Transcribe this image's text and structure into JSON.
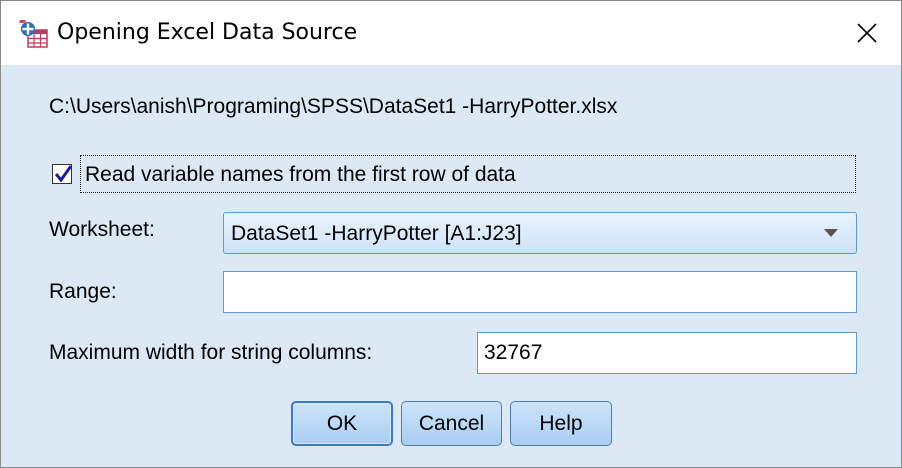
{
  "window": {
    "title": "Opening Excel Data Source",
    "app_icon": "spss-data-icon",
    "close_icon": "close-icon"
  },
  "file_path": "C:\\Users\\anish\\Programing\\SPSS\\DataSet1 -HarryPotter.xlsx",
  "read_names": {
    "label": "Read variable names from the first row of data",
    "checked": true
  },
  "worksheet": {
    "label": "Worksheet:",
    "selected": "DataSet1 -HarryPotter [A1:J23]",
    "arrow_icon": "dropdown-arrow-icon"
  },
  "range": {
    "label": "Range:",
    "value": ""
  },
  "max_width": {
    "label": "Maximum width for string columns:",
    "value": "32767"
  },
  "buttons": {
    "ok": "OK",
    "cancel": "Cancel",
    "help": "Help"
  },
  "colors": {
    "dialog_background": "#dce9f5",
    "field_border": "#5a9ad8",
    "checkmark": "#1a1aa8"
  }
}
